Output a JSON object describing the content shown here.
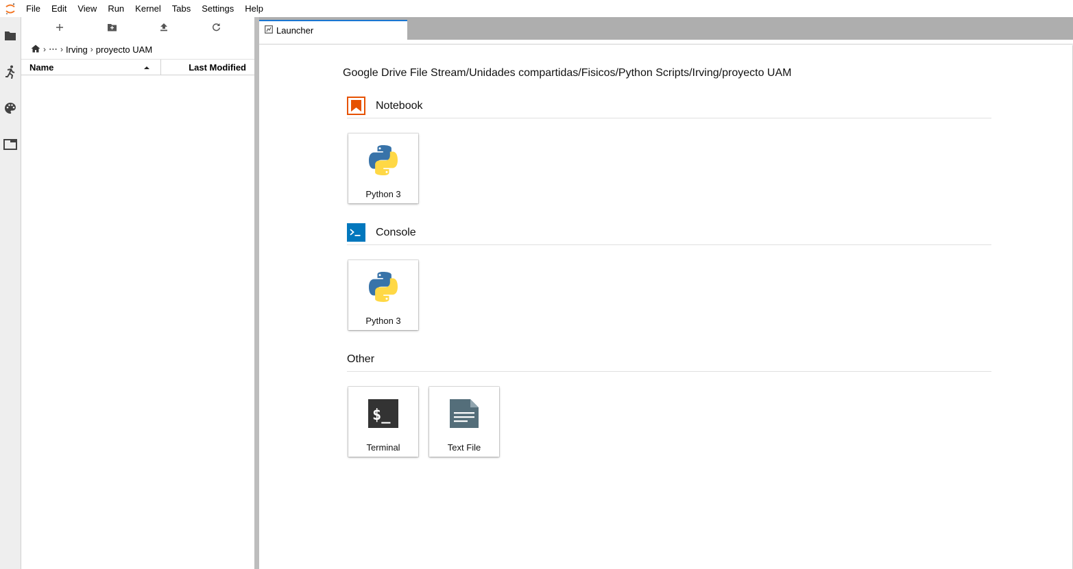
{
  "menu": [
    "File",
    "Edit",
    "View",
    "Run",
    "Kernel",
    "Tabs",
    "Settings",
    "Help"
  ],
  "activity": [
    "folder-icon",
    "running-icon",
    "palette-icon",
    "tabs-icon"
  ],
  "filebrowser": {
    "toolbar": [
      "new-launcher-icon",
      "new-folder-icon",
      "upload-icon",
      "refresh-icon"
    ],
    "breadcrumb": {
      "ellipsis": "⋯",
      "part1": "Irving",
      "part2": "proyecto UAM"
    },
    "columns": {
      "name": "Name",
      "modified": "Last Modified"
    }
  },
  "tabs": [
    {
      "label": "Launcher"
    }
  ],
  "launcher": {
    "cwd": "Google Drive File Stream/Unidades compartidas/Fisicos/Python Scripts/Irving/proyecto UAM",
    "sections": {
      "notebook": {
        "title": "Notebook",
        "cards": [
          "Python 3"
        ]
      },
      "console": {
        "title": "Console",
        "cards": [
          "Python 3"
        ]
      },
      "other": {
        "title": "Other",
        "cards": [
          "Terminal",
          "Text File"
        ]
      }
    }
  },
  "colors": {
    "accent": "#1976d2",
    "notebook": "#e65100",
    "console": "#0277bd",
    "terminal": "#333333",
    "textfile": "#546e7a",
    "python_blue": "#3873a9",
    "python_yellow": "#ffd845"
  }
}
